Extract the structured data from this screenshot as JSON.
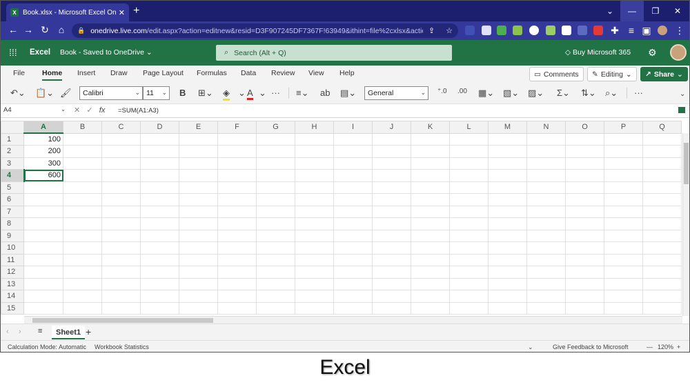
{
  "browser": {
    "tab_title": "Book.xlsx - Microsoft Excel Online",
    "tab_icon_letter": "X",
    "url_host": "onedrive.live.com",
    "url_path": "/edit.aspx?action=editnew&resid=D3F907245DF7367F!63949&ithint=file%2cxlsx&actio..."
  },
  "app": {
    "name": "Excel",
    "doc_status": "Book  -  Saved to OneDrive",
    "search_placeholder": "Search (Alt + Q)",
    "buy_label": "Buy Microsoft 365"
  },
  "ribbon": {
    "tabs": [
      "File",
      "Home",
      "Insert",
      "Draw",
      "Page Layout",
      "Formulas",
      "Data",
      "Review",
      "View",
      "Help"
    ],
    "active_tab": "Home",
    "comments_label": "Comments",
    "editing_label": "Editing",
    "share_label": "Share"
  },
  "toolbar": {
    "font_name": "Calibri",
    "font_size": "11",
    "number_format": "General"
  },
  "formula_bar": {
    "name_box": "A4",
    "formula": "=SUM(A1:A3)"
  },
  "sheet": {
    "columns": [
      "A",
      "B",
      "C",
      "D",
      "E",
      "F",
      "G",
      "H",
      "I",
      "J",
      "K",
      "L",
      "M",
      "N",
      "O",
      "P",
      "Q"
    ],
    "rows": [
      "1",
      "2",
      "3",
      "4",
      "5",
      "6",
      "7",
      "8",
      "9",
      "10",
      "11",
      "12",
      "13",
      "14",
      "15"
    ],
    "col_a_values": [
      "100",
      "200",
      "300",
      "600"
    ],
    "active_cell": "A4",
    "sheet_tab": "Sheet1"
  },
  "status": {
    "calc_mode": "Calculation Mode: Automatic",
    "workbook_stats": "Workbook Statistics",
    "feedback": "Give Feedback to Microsoft",
    "zoom": "120%"
  },
  "caption": "Excel",
  "colors": {
    "excel_green": "#217346",
    "browser_frame": "#1c1f6e",
    "address_bar": "#33389a"
  }
}
